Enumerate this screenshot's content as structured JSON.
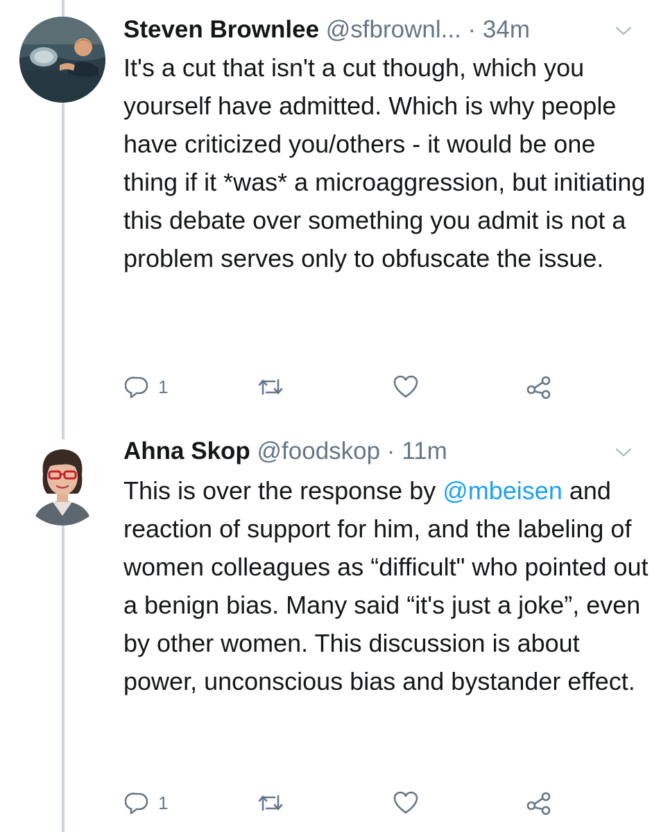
{
  "tweets": [
    {
      "author": "Steven Brownlee",
      "handle": "@sfbrownl...",
      "time": "· 34m",
      "text": "It's a cut that isn't a cut though, which you yourself have admitted. Which is why people have criticized you/others - it would be one thing if it *was* a microaggression, but initiating this debate over something you admit is not a problem serves only to obfuscate the issue.",
      "reply_count": "1",
      "avatar_icon": "avatar-swimmer"
    },
    {
      "author": "Ahna Skop",
      "handle": "@foodskop",
      "time": "· 11m",
      "text_before": "This is over the response by ",
      "mention": "@mbeisen",
      "text_after": " and reaction of support for him, and the labeling of women colleagues as “difficult\" who pointed out a benign bias. Many said “it's just a joke”, even by other women. This discussion is about power, unconscious bias and bystander effect.",
      "reply_count": "1",
      "avatar_icon": "avatar-woman-glasses"
    }
  ],
  "colors": {
    "text": "#14171a",
    "secondary": "#657786",
    "link": "#1da1f2",
    "thread_line": "#ccd6dd"
  }
}
